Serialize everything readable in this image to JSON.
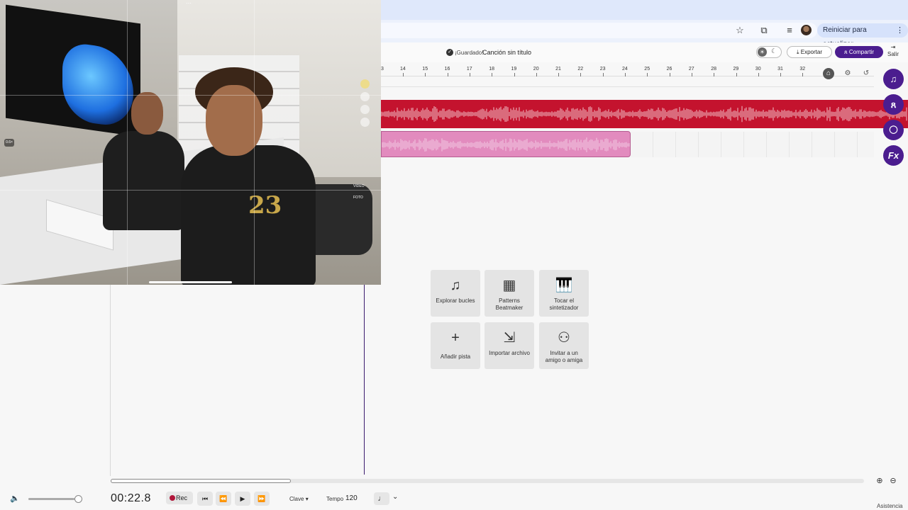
{
  "browser": {
    "reload_button_label": "Reiniciar para actualizar",
    "icons": [
      "star-icon",
      "cast-icon",
      "playlist-icon",
      "profile-avatar",
      "kebab-menu-icon"
    ]
  },
  "header": {
    "saved_label": "¡Guardado!",
    "song_title": "Canción sin título",
    "export_label": "Exportar",
    "share_label": "Compartir",
    "exit_label": "Salir"
  },
  "ruler": {
    "first_partial": "3",
    "marks": [
      "14",
      "15",
      "16",
      "17",
      "18",
      "19",
      "20",
      "21",
      "22",
      "23",
      "24",
      "25",
      "26",
      "27",
      "28",
      "29",
      "30",
      "31",
      "32"
    ]
  },
  "tracks": [
    {
      "color": "#c4132e",
      "type": "audio-region"
    },
    {
      "color": "#e28bbe",
      "type": "audio-region"
    }
  ],
  "video_overlay": {
    "zoom_label": "0.6×",
    "mode_labels": [
      "VIDEO",
      "FOTO"
    ],
    "jersey_number": "23"
  },
  "quick_actions": [
    {
      "icon": "music-note-icon",
      "label": "Explorar bucles"
    },
    {
      "icon": "patterns-grid-icon",
      "label": "Patterns Beatmaker"
    },
    {
      "icon": "piano-icon",
      "label": "Tocar el sintetizador"
    },
    {
      "icon": "plus-icon",
      "label": "Añadir pista"
    },
    {
      "icon": "import-icon",
      "label": "Importar archivo"
    },
    {
      "icon": "invite-user-icon",
      "label": "Invitar a un amigo o amiga"
    }
  ],
  "side_buttons": [
    {
      "icon": "music-note-icon",
      "label": "♫"
    },
    {
      "icon": "collaborators-icon",
      "label": "ጸ"
    },
    {
      "icon": "chat-icon",
      "label": "💬"
    },
    {
      "icon": "fx-icon",
      "label": "Fx"
    }
  ],
  "transport": {
    "time": "00:22.8",
    "rec_label": "Rec",
    "key_label": "Clave",
    "tempo_label": "Tempo",
    "tempo_value": "120",
    "volume_level": 0.85
  },
  "footer": {
    "assist_label": "Asistencia"
  }
}
